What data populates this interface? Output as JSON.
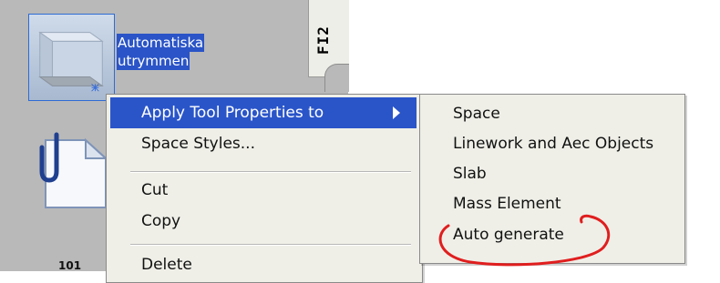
{
  "palette": {
    "tab_label": "FI2",
    "tool_label_line1": "Automatiska",
    "tool_label_line2": "utrymmen",
    "tool_101_label": "101"
  },
  "context_menu": {
    "items": [
      {
        "label": "Apply Tool Properties to"
      },
      {
        "label": "Space Styles..."
      },
      {
        "label": "Cut"
      },
      {
        "label": "Copy"
      },
      {
        "label": "Delete"
      }
    ]
  },
  "submenu": {
    "items": [
      {
        "label": "Space"
      },
      {
        "label": "Linework and Aec Objects"
      },
      {
        "label": "Slab"
      },
      {
        "label": "Mass Element"
      },
      {
        "label": "Auto generate"
      }
    ]
  },
  "colors": {
    "menu_highlight": "#2a55c9",
    "annotation": "#e01e1e",
    "palette_background": "#b9b9b9"
  }
}
